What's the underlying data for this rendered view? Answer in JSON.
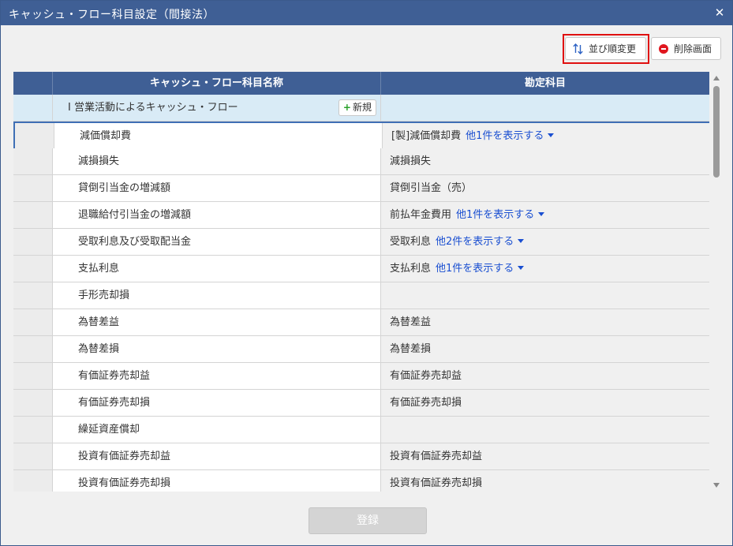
{
  "window": {
    "title": "キャッシュ・フロー科目設定（間接法）"
  },
  "toolbar": {
    "sort_label": "並び順変更",
    "delete_label": "削除画面"
  },
  "table": {
    "headers": [
      "",
      "キャッシュ・フロー科目名称",
      "勘定科目"
    ],
    "section": {
      "label": "Ⅰ 営業活動によるキャッシュ・フロー",
      "new_label": "新規"
    },
    "rows": [
      {
        "name": "減価償却費",
        "account": "[製]減価償却費",
        "more": "他1件を表示する"
      },
      {
        "name": "減損損失",
        "account": "減損損失",
        "more": ""
      },
      {
        "name": "貸倒引当金の増減額",
        "account": "貸倒引当金（売）",
        "more": ""
      },
      {
        "name": "退職給付引当金の増減額",
        "account": "前払年金費用",
        "more": "他1件を表示する"
      },
      {
        "name": "受取利息及び受取配当金",
        "account": "受取利息",
        "more": "他2件を表示する"
      },
      {
        "name": "支払利息",
        "account": "支払利息",
        "more": "他1件を表示する"
      },
      {
        "name": "手形売却損",
        "account": "",
        "more": ""
      },
      {
        "name": "為替差益",
        "account": "為替差益",
        "more": ""
      },
      {
        "name": "為替差損",
        "account": "為替差損",
        "more": ""
      },
      {
        "name": "有価証券売却益",
        "account": "有価証券売却益",
        "more": ""
      },
      {
        "name": "有価証券売却損",
        "account": "有価証券売却損",
        "more": ""
      },
      {
        "name": "繰延資産償却",
        "account": "",
        "more": ""
      },
      {
        "name": "投資有価証券売却益",
        "account": "投資有価証券売却益",
        "more": ""
      },
      {
        "name": "投資有価証券売却損",
        "account": "投資有価証券売却損",
        "more": ""
      }
    ]
  },
  "footer": {
    "submit_label": "登録"
  },
  "colors": {
    "header_bg": "#3f5f95",
    "section_bg": "#d9ebf6",
    "link": "#1a4fd1",
    "highlight_border": "#e01010"
  }
}
